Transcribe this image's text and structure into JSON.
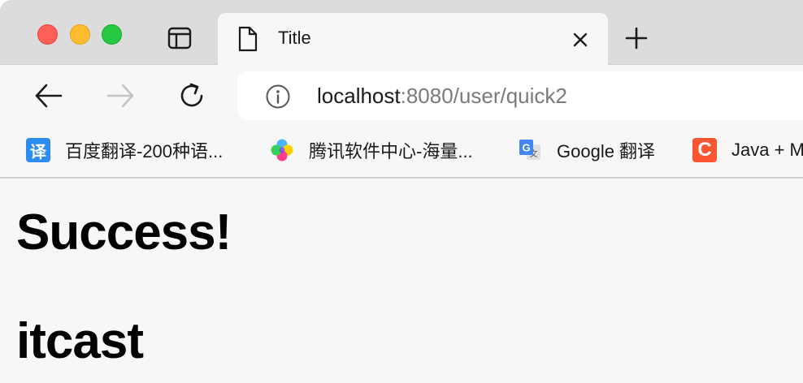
{
  "tab": {
    "title": "Title"
  },
  "address_bar": {
    "host": "localhost",
    "rest": ":8080/user/quick2"
  },
  "bookmarks": [
    {
      "label": "百度翻译-200种语...",
      "icon": "fanyi-icon",
      "icon_text": "译"
    },
    {
      "label": "腾讯软件中心-海量...",
      "icon": "qq-software-icon"
    },
    {
      "label": "Google 翻译",
      "icon": "google-translate-icon"
    },
    {
      "label": "Java + M",
      "icon": "csdn-icon",
      "icon_text": "C"
    }
  ],
  "page": {
    "headings": [
      "Success!",
      "itcast"
    ]
  },
  "colors": {
    "close": "#fe5f57",
    "minimize": "#febc2e",
    "zoom": "#28c840",
    "tab_bar": "#dcdcdc",
    "page_bg": "#f7f7f7"
  }
}
